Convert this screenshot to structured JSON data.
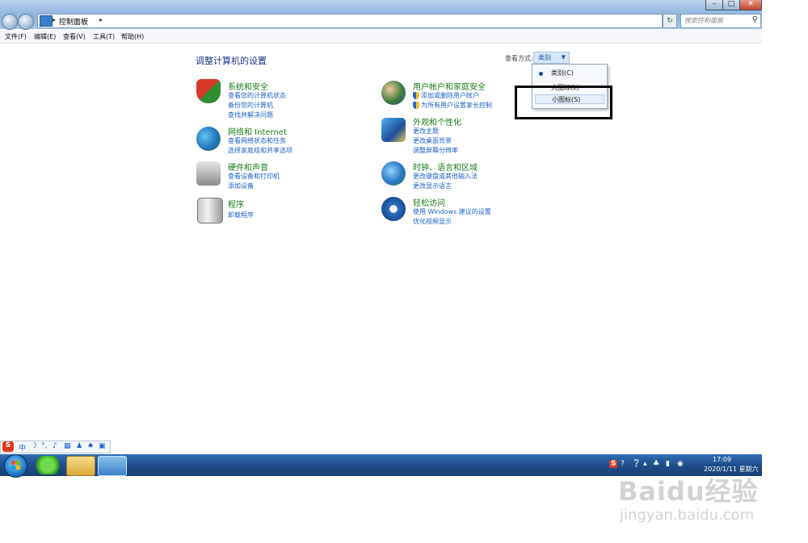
{
  "window": {
    "address": {
      "crumb": "控制面板",
      "sep": "▸"
    },
    "search_placeholder": "搜索控制面板",
    "buttons": {
      "minimize": "–",
      "maximize": "□",
      "close": "✕"
    }
  },
  "menubar": [
    "文件(F)",
    "编辑(E)",
    "查看(V)",
    "工具(T)",
    "帮助(H)"
  ],
  "main": {
    "title": "调整计算机的设置",
    "view_by_label": "查看方式:",
    "view_by_value": "类别",
    "view_menu": {
      "category": "类别(C)",
      "large_icons": "大图标(L)",
      "small_icons": "小图标(S)"
    }
  },
  "categories_left": [
    {
      "title": "系统和安全",
      "icon": "shield-icon",
      "links": [
        "查看您的计算机状态",
        "备份您的计算机",
        "查找并解决问题"
      ]
    },
    {
      "title": "网络和 Internet",
      "icon": "network-icon",
      "links": [
        "查看网络状态和任务",
        "选择家庭组和共享选项"
      ]
    },
    {
      "title": "硬件和声音",
      "icon": "printer-icon",
      "links": [
        "查看设备和打印机",
        "添加设备"
      ]
    },
    {
      "title": "程序",
      "icon": "programs-icon",
      "links": [
        "卸载程序"
      ]
    }
  ],
  "categories_right": [
    {
      "title": "用户帐户和家庭安全",
      "icon": "users-icon",
      "links": [
        "添加或删除用户帐户",
        "为所有用户设置家长控制"
      ]
    },
    {
      "title": "外观和个性化",
      "icon": "appearance-icon",
      "links": [
        "更改主题",
        "更改桌面背景",
        "调整屏幕分辨率"
      ]
    },
    {
      "title": "时钟、语言和区域",
      "icon": "globe-clock-icon",
      "links": [
        "更改键盘或其他输入法",
        "更改显示语言"
      ]
    },
    {
      "title": "轻松访问",
      "icon": "accessibility-icon",
      "links": [
        "使用 Windows 建议的设置",
        "优化视频显示"
      ]
    }
  ],
  "ime_bar": {
    "logo": "S",
    "mode": "中"
  },
  "tray": {
    "time": "17:09",
    "date": "2020/1/11 星期六"
  },
  "watermark": {
    "line1": "Baidu经验",
    "line2": "jingyan.baidu.com"
  },
  "colors": {
    "link": "#1f5fc4",
    "category_title": "#1b7a1b",
    "page_title": "#1e3287",
    "taskbar": "#1d4e8c"
  }
}
